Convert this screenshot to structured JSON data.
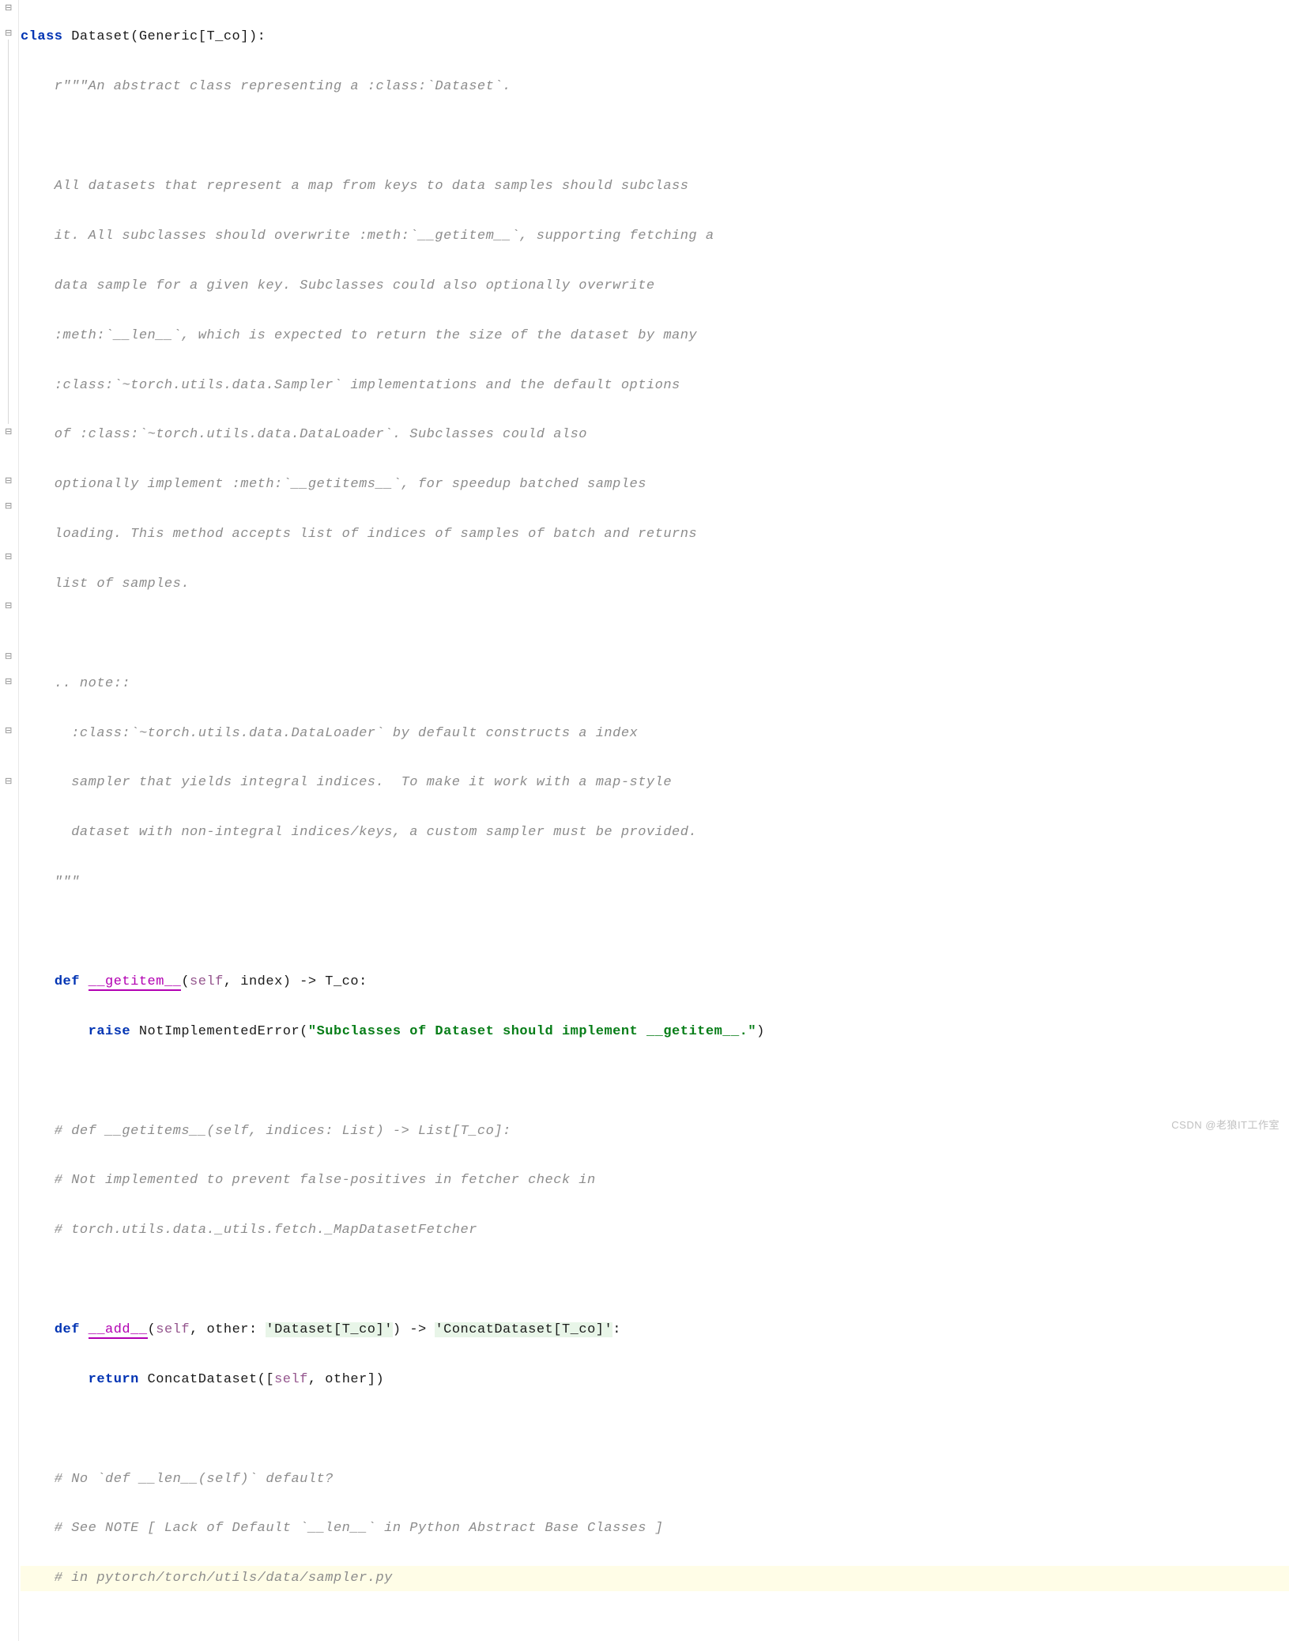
{
  "code": {
    "l1_kw_class": "class",
    "l1_name": "Dataset",
    "l1_paren": "(Generic[T_co]):",
    "l2": "    r\"\"\"An abstract class representing a :class:`Dataset`.",
    "l3": "",
    "l4": "    All datasets that represent a map from keys to data samples should subclass",
    "l5": "    it. All subclasses should overwrite :meth:`__getitem__`, supporting fetching a",
    "l6": "    data sample for a given key. Subclasses could also optionally overwrite",
    "l7": "    :meth:`__len__`, which is expected to return the size of the dataset by many",
    "l8": "    :class:`~torch.utils.data.Sampler` implementations and the default options",
    "l9": "    of :class:`~torch.utils.data.DataLoader`. Subclasses could also",
    "l10": "    optionally implement :meth:`__getitems__`, for speedup batched samples",
    "l11": "    loading. This method accepts list of indices of samples of batch and returns",
    "l12": "    list of samples.",
    "l13": "",
    "l14": "    .. note::",
    "l15": "      :class:`~torch.utils.data.DataLoader` by default constructs a index",
    "l16": "      sampler that yields integral indices.  To make it work with a map-style",
    "l17": "      dataset with non-integral indices/keys, a custom sampler must be provided.",
    "l18": "    \"\"\"",
    "l19": "",
    "l20_def": "def",
    "l20_fn": "__getitem__",
    "l20_sig1": "(",
    "l20_self": "self",
    "l20_sig2": ", index) -> T_co:",
    "l21_raise": "raise",
    "l21_err": " NotImplementedError(",
    "l21_str": "\"Subclasses of Dataset should implement __getitem__.\"",
    "l21_end": ")",
    "l22": "",
    "l23": "    # def __getitems__(self, indices: List) -> List[T_co]:",
    "l24": "    # Not implemented to prevent false-positives in fetcher check in",
    "l25": "    # torch.utils.data._utils.fetch._MapDatasetFetcher",
    "l26": "",
    "l27_def": "def",
    "l27_fn": "__add__",
    "l27_sig1": "(",
    "l27_self": "self",
    "l27_sig2": ", other: ",
    "l27_typ1": "'Dataset[T_co]'",
    "l27_sig3": ") -> ",
    "l27_typ2": "'ConcatDataset[T_co]'",
    "l27_sig4": ":",
    "l28_ret": "return",
    "l28_call": " ConcatDataset([",
    "l28_self": "self",
    "l28_rest": ", other])",
    "l29": "",
    "l30": "    # No `def __len__(self)` default?",
    "l31": "    # See NOTE [ Lack of Default `__len__` in Python Abstract Base Classes ]",
    "l32": "    # in pytorch/torch/utils/data/sampler.py"
  },
  "watermark": "CSDN @老狼IT工作室"
}
